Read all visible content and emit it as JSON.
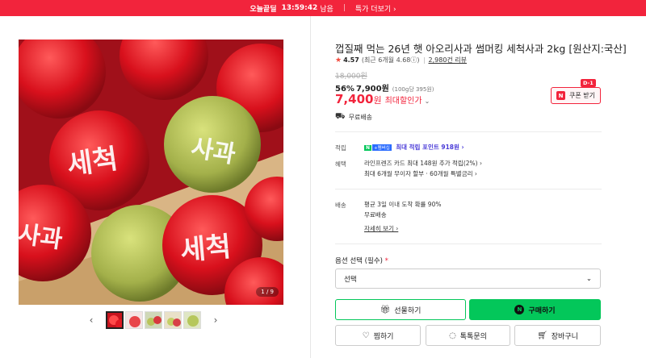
{
  "topbar": {
    "brand": "오늘끝딜",
    "timer": "13:59:42",
    "timer_suffix": "남음",
    "more_link": "특가 더보기 ›"
  },
  "gallery": {
    "image_alt": "세척사과 상자",
    "counter": "1 / 9",
    "thumbnail_count": 5,
    "active_thumbnail": 1
  },
  "product": {
    "title": "껍질째 먹는 26년 햇 아오리사과 썸머킹 세척사과 2kg [원산지:국산]",
    "rating": "4.57",
    "rating_detail": "(최근 6개월 4.68ⓘ)",
    "reviews": "2,980건 리뷰",
    "original_price": "18,000원",
    "discount_pct": "56%",
    "sale_price": "7,900원",
    "unit_price": "(100g당 395원)",
    "final_price": "7,400",
    "final_won": "원",
    "final_label": "최대할인가",
    "final_chevron": "⌄",
    "coupon_label": "쿠폰 받기",
    "coupon_badge": "D-1",
    "shipping_label": "무료배송"
  },
  "benefits": {
    "points_label": "적립",
    "points_badge_n": "N",
    "points_badge_plus": "+멤버십",
    "points_text": "최대 적립 포인트 918원 ›",
    "benefit_label": "혜택",
    "benefit_line1": "라인프렌즈 카드 최대 148원 추가 적립(2%) ›",
    "benefit_line2": "최대 6개월 무이자 할부 · 60개월 특별금리 ›"
  },
  "delivery": {
    "label": "배송",
    "line1": "평균 3일 이내 도착 확률 90%",
    "line2": "무료배송",
    "detail_link": "자세히 보기 ›"
  },
  "options": {
    "label": "옵션 선택 (필수)",
    "required_mark": "*",
    "select_value": "선택"
  },
  "actions": {
    "gift": "선물하기",
    "buy": "구매하기",
    "buy_mark": "N",
    "wish": "찜하기",
    "talk": "톡톡문의",
    "cart": "장바구니"
  },
  "colors": {
    "accent": "#f2243c",
    "buy_green": "#03c75a",
    "point_purple": "#4a3bd8"
  }
}
